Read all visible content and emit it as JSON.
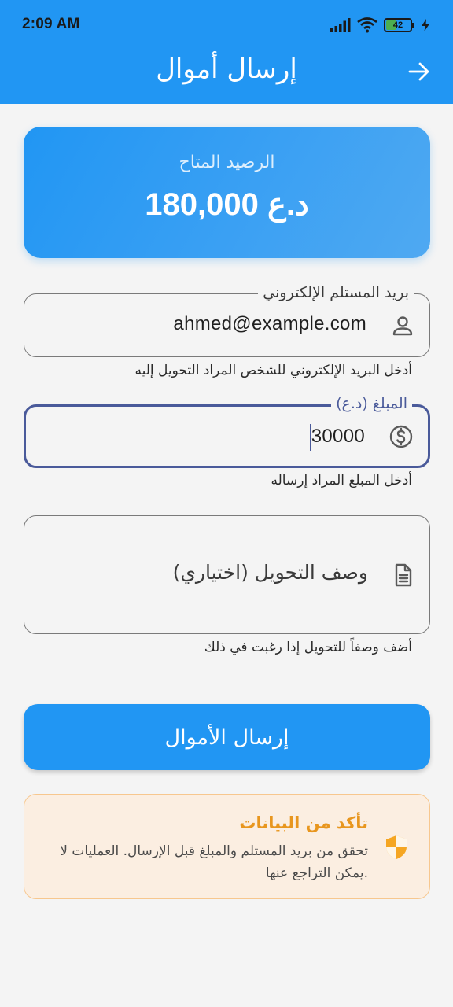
{
  "status_bar": {
    "time": "2:09 AM",
    "battery_level": "42",
    "battery_fraction": 0.42,
    "icons": [
      "signal-icon",
      "wifi-icon",
      "battery-icon",
      "charging-icon"
    ]
  },
  "header": {
    "title": "إرسال أموال",
    "back_icon": "arrow-right-icon",
    "background_color": "#2196f3"
  },
  "balance": {
    "label": "الرصيد المتاح",
    "amount": "180,000 د.ع"
  },
  "form": {
    "email": {
      "label": "بريد المستلم الإلكتروني",
      "value": "ahmed@example.com",
      "helper": "أدخل البريد الإلكتروني للشخص المراد التحويل إليه",
      "icon": "person-icon"
    },
    "amount": {
      "label": "المبلغ (د.ع)",
      "value": "30000",
      "helper": "أدخل المبلغ المراد إرساله",
      "icon": "dollar-circle-icon",
      "focus_color": "#4a5a9a"
    },
    "description": {
      "placeholder": "وصف التحويل (اختياري)",
      "helper": "أضف وصفاً للتحويل إذا رغبت في ذلك",
      "icon": "document-icon"
    }
  },
  "submit_button": {
    "label": "إرسال الأموال"
  },
  "warning": {
    "title": "تأكد من البيانات",
    "text": "تحقق من بريد المستلم والمبلغ قبل الإرسال. العمليات لا يمكن التراجع عنها.",
    "icon": "shield-icon",
    "accent_color": "#e8961e"
  }
}
